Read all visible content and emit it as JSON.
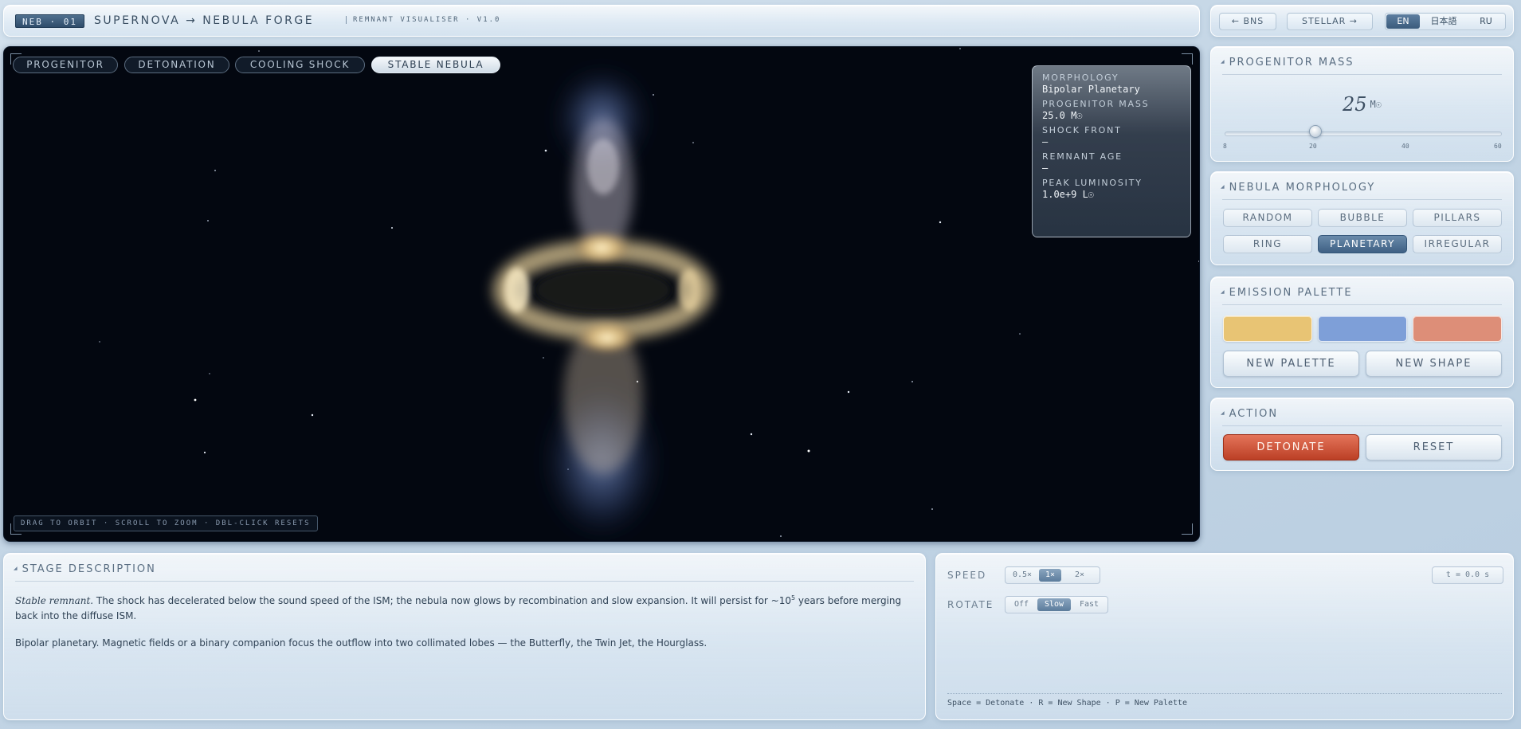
{
  "header": {
    "badge": "NEB · 01",
    "title": "SUPERNOVA → NEBULA FORGE",
    "subtitle": "REMNANT VISUALISER · V1.0"
  },
  "nav": {
    "prev_label": "← BNS",
    "next_label": "STELLAR →",
    "languages": [
      "EN",
      "日本語",
      "RU"
    ],
    "active_language": "EN"
  },
  "viewport": {
    "stages": [
      "PROGENITOR",
      "DETONATION",
      "COOLING SHOCK",
      "STABLE NEBULA"
    ],
    "active_stage": "STABLE NEBULA",
    "hint": "DRAG TO ORBIT · SCROLL TO ZOOM · DBL-CLICK RESETS",
    "readout": [
      {
        "label": "Morphology",
        "value": "Bipolar Planetary"
      },
      {
        "label": "Progenitor Mass",
        "value": "25.0 M☉"
      },
      {
        "label": "Shock Front",
        "value": "—"
      },
      {
        "label": "Remnant Age",
        "value": "—"
      },
      {
        "label": "Peak Luminosity",
        "value": "1.0e+9 L☉"
      }
    ]
  },
  "mass": {
    "title": "Progenitor Mass",
    "value": "25",
    "unit": "M☉",
    "min": 8,
    "max": 60,
    "ticks": [
      "8",
      "20",
      "40",
      "60"
    ]
  },
  "morphology": {
    "title": "Nebula Morphology",
    "options": [
      "RANDOM",
      "BUBBLE",
      "PILLARS",
      "RING",
      "PLANETARY",
      "IRREGULAR"
    ],
    "active": "PLANETARY"
  },
  "palette": {
    "title": "Emission Palette",
    "swatches": [
      "#e8c474",
      "#7e9fd8",
      "#dd8e78"
    ],
    "new_palette_label": "New Palette",
    "new_shape_label": "New Shape"
  },
  "action": {
    "title": "Action",
    "detonate_label": "Detonate",
    "reset_label": "Reset"
  },
  "description": {
    "title": "Stage Description",
    "lead": "Stable remnant.",
    "para1_a": " The shock has decelerated below the sound speed of the ISM; the nebula now glows by recombination and slow expansion. It will persist for ~10",
    "para1_sup": "5",
    "para1_b": " years before merging back into the diffuse ISM.",
    "para2": "Bipolar planetary. Magnetic fields or a binary companion focus the outflow into two collimated lobes — the Butterfly, the Twin Jet, the Hourglass."
  },
  "controls": {
    "speed_label": "SPEED",
    "speed_options": [
      "0.5×",
      "1×",
      "2×"
    ],
    "speed_active": "1×",
    "rotate_label": "ROTATE",
    "rotate_options": [
      "Off",
      "Slow",
      "Fast"
    ],
    "rotate_active": "Slow",
    "timer": "t = 0.0 s",
    "shortcuts": "Space = Detonate · R = New Shape · P = New Palette"
  },
  "colors": {
    "accent": "#3f6084",
    "danger": "#bb3f25",
    "space": "#030710"
  }
}
